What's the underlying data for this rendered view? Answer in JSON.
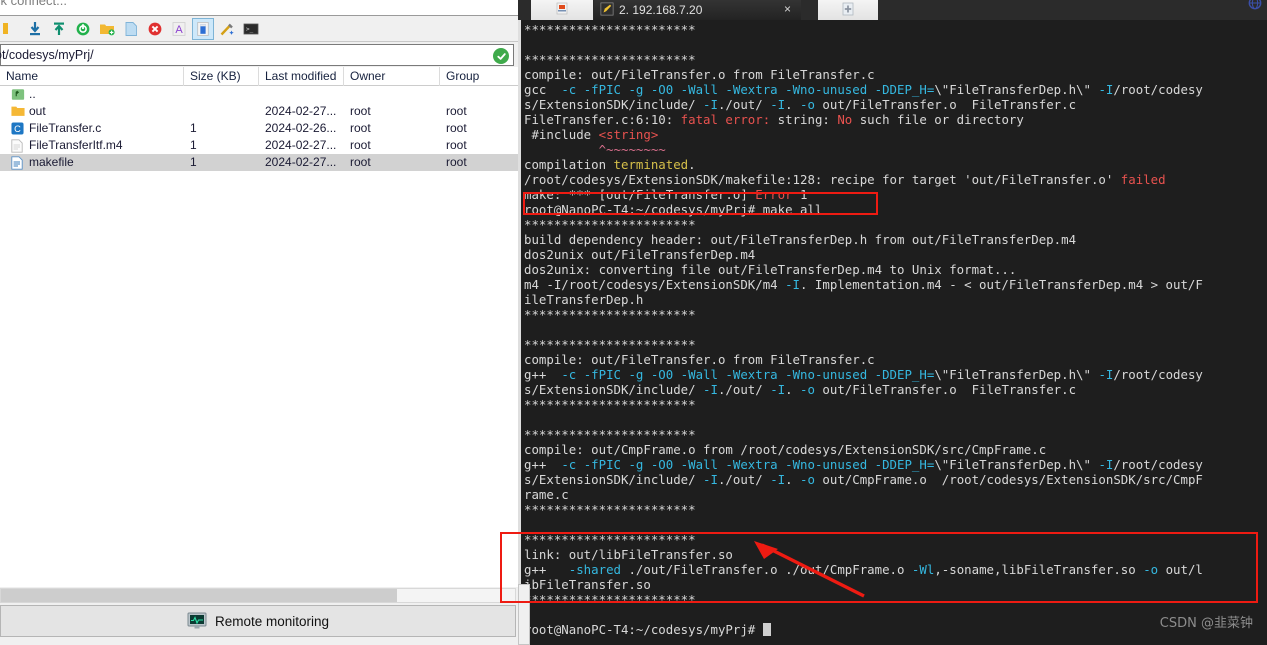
{
  "window": {
    "quick_connect_text": "ck connect...",
    "corner_icon": "globe-icon"
  },
  "file_manager": {
    "toolbar_items": [
      {
        "name": "download-icon",
        "label": "Download"
      },
      {
        "name": "download-arrow-icon",
        "label": "Download selected"
      },
      {
        "name": "upload-arrow-icon",
        "label": "Upload"
      },
      {
        "name": "refresh-icon",
        "label": "Refresh"
      },
      {
        "name": "new-folder-icon",
        "label": "New folder"
      },
      {
        "name": "new-file-icon",
        "label": "New file"
      },
      {
        "name": "delete-icon",
        "label": "Delete"
      },
      {
        "name": "rename-icon",
        "label": "Rename"
      },
      {
        "name": "properties-icon",
        "label": "Properties"
      },
      {
        "name": "magic-wand-icon",
        "label": "Tools"
      },
      {
        "name": "terminal-icon",
        "label": "Open terminal"
      }
    ],
    "address": {
      "path": "ot/codesys/myPrj/",
      "check_icon": "check-circle-icon"
    },
    "columns": [
      "Name",
      "Size (KB)",
      "Last modified",
      "Owner",
      "Group"
    ],
    "rows": [
      {
        "icon": "parent-folder-icon",
        "name": "..",
        "size": "",
        "modified": "",
        "owner": "",
        "group": "",
        "selected": false
      },
      {
        "icon": "folder-icon",
        "name": "out",
        "size": "",
        "modified": "2024-02-27...",
        "owner": "root",
        "group": "root",
        "selected": false
      },
      {
        "icon": "c-file-icon",
        "name": "FileTransfer.c",
        "size": "1",
        "modified": "2024-02-26...",
        "owner": "root",
        "group": "root",
        "selected": false
      },
      {
        "icon": "text-file-icon",
        "name": "FileTransferItf.m4",
        "size": "1",
        "modified": "2024-02-27...",
        "owner": "root",
        "group": "root",
        "selected": false
      },
      {
        "icon": "doc-file-icon",
        "name": "makefile",
        "size": "1",
        "modified": "2024-02-27...",
        "owner": "root",
        "group": "root",
        "selected": true
      }
    ],
    "bottom_bar": {
      "icon": "monitor-icon",
      "label": "Remote monitoring"
    }
  },
  "terminal": {
    "tabs": [
      {
        "label": "",
        "icon": "session-icon",
        "active": false
      },
      {
        "label": "2. 192.168.7.20",
        "icon": "pencil-icon",
        "active": true,
        "close": "×"
      },
      {
        "label": "+",
        "icon": "new-tab-icon",
        "active": false
      }
    ],
    "prompt": "root@NanoPC-T4:~/codesys/myPrj#",
    "lines": [
      [
        {
          "t": "***********************",
          "c": "white"
        }
      ],
      [
        {
          "t": "",
          "c": "white"
        }
      ],
      [
        {
          "t": "***********************",
          "c": "white"
        }
      ],
      [
        {
          "t": "compile: out/FileTransfer.o from FileTransfer.c",
          "c": "white"
        }
      ],
      [
        {
          "t": "gcc  ",
          "c": "white"
        },
        {
          "t": "-c -fPIC -g -O0 -Wall -Wextra -Wno-unused -DDEP_H=",
          "c": "cyan"
        },
        {
          "t": "\\\"FileTransferDep.h\\\" ",
          "c": "white"
        },
        {
          "t": "-I",
          "c": "cyan"
        },
        {
          "t": "/root/codesy",
          "c": "white"
        }
      ],
      [
        {
          "t": "s/ExtensionSDK/include/ ",
          "c": "white"
        },
        {
          "t": "-I",
          "c": "cyan"
        },
        {
          "t": "./out/ ",
          "c": "white"
        },
        {
          "t": "-I",
          "c": "cyan"
        },
        {
          "t": ". ",
          "c": "white"
        },
        {
          "t": "-o",
          "c": "cyan"
        },
        {
          "t": " out/FileTransfer.o  FileTransfer.c",
          "c": "white"
        }
      ],
      [
        {
          "t": "FileTransfer.c:6:10: ",
          "c": "white"
        },
        {
          "t": "fatal error:",
          "c": "red"
        },
        {
          "t": " string: ",
          "c": "white"
        },
        {
          "t": "No",
          "c": "red"
        },
        {
          "t": " such file or directory",
          "c": "white"
        }
      ],
      [
        {
          "t": " #include ",
          "c": "white"
        },
        {
          "t": "<string>",
          "c": "red"
        }
      ],
      [
        {
          "t": "          ",
          "c": "white"
        },
        {
          "t": "^~~~~~~~~",
          "c": "pink"
        }
      ],
      [
        {
          "t": "compilation ",
          "c": "white"
        },
        {
          "t": "terminated",
          "c": "yellow"
        },
        {
          "t": ".",
          "c": "white"
        }
      ],
      [
        {
          "t": "/root/codesys/ExtensionSDK/makefile:128: recipe for target 'out/FileTransfer.o' ",
          "c": "white"
        },
        {
          "t": "failed",
          "c": "red"
        }
      ],
      [
        {
          "t": "make: *** [out/FileTransfer.o] ",
          "c": "white"
        },
        {
          "t": "Error",
          "c": "red"
        },
        {
          "t": " 1",
          "c": "white"
        }
      ],
      [
        {
          "t": "root@NanoPC-T4:~/codesys/myPrj# make all",
          "c": "white"
        }
      ],
      [
        {
          "t": "***********************",
          "c": "white"
        }
      ],
      [
        {
          "t": "build dependency header: out/FileTransferDep.h from out/FileTransferDep.m4",
          "c": "white"
        }
      ],
      [
        {
          "t": "dos2unix out/FileTransferDep.m4",
          "c": "white"
        }
      ],
      [
        {
          "t": "dos2unix: converting file out/FileTransferDep.m4 to Unix format...",
          "c": "white"
        }
      ],
      [
        {
          "t": "m4 -I/root/codesys/ExtensionSDK/m4 ",
          "c": "white"
        },
        {
          "t": "-I",
          "c": "cyan"
        },
        {
          "t": ". Implementation.m4 - < out/FileTransferDep.m4 > out/F",
          "c": "white"
        }
      ],
      [
        {
          "t": "ileTransferDep.h",
          "c": "white"
        }
      ],
      [
        {
          "t": "***********************",
          "c": "white"
        }
      ],
      [
        {
          "t": "",
          "c": "white"
        }
      ],
      [
        {
          "t": "***********************",
          "c": "white"
        }
      ],
      [
        {
          "t": "compile: out/FileTransfer.o from FileTransfer.c",
          "c": "white"
        }
      ],
      [
        {
          "t": "g++  ",
          "c": "white"
        },
        {
          "t": "-c -fPIC -g -O0 -Wall -Wextra -Wno-unused -DDEP_H=",
          "c": "cyan"
        },
        {
          "t": "\\\"FileTransferDep.h\\\" ",
          "c": "white"
        },
        {
          "t": "-I",
          "c": "cyan"
        },
        {
          "t": "/root/codesy",
          "c": "white"
        }
      ],
      [
        {
          "t": "s/ExtensionSDK/include/ ",
          "c": "white"
        },
        {
          "t": "-I",
          "c": "cyan"
        },
        {
          "t": "./out/ ",
          "c": "white"
        },
        {
          "t": "-I",
          "c": "cyan"
        },
        {
          "t": ". ",
          "c": "white"
        },
        {
          "t": "-o",
          "c": "cyan"
        },
        {
          "t": " out/FileTransfer.o  FileTransfer.c",
          "c": "white"
        }
      ],
      [
        {
          "t": "***********************",
          "c": "white"
        }
      ],
      [
        {
          "t": "",
          "c": "white"
        }
      ],
      [
        {
          "t": "***********************",
          "c": "white"
        }
      ],
      [
        {
          "t": "compile: out/CmpFrame.o from /root/codesys/ExtensionSDK/src/CmpFrame.c",
          "c": "white"
        }
      ],
      [
        {
          "t": "g++  ",
          "c": "white"
        },
        {
          "t": "-c -fPIC -g -O0 -Wall -Wextra -Wno-unused -DDEP_H=",
          "c": "cyan"
        },
        {
          "t": "\\\"FileTransferDep.h\\\" ",
          "c": "white"
        },
        {
          "t": "-I",
          "c": "cyan"
        },
        {
          "t": "/root/codesy",
          "c": "white"
        }
      ],
      [
        {
          "t": "s/ExtensionSDK/include/ ",
          "c": "white"
        },
        {
          "t": "-I",
          "c": "cyan"
        },
        {
          "t": "./out/ ",
          "c": "white"
        },
        {
          "t": "-I",
          "c": "cyan"
        },
        {
          "t": ". ",
          "c": "white"
        },
        {
          "t": "-o",
          "c": "cyan"
        },
        {
          "t": " out/CmpFrame.o  /root/codesys/ExtensionSDK/src/CmpF",
          "c": "white"
        }
      ],
      [
        {
          "t": "rame.c",
          "c": "white"
        }
      ],
      [
        {
          "t": "***********************",
          "c": "white"
        }
      ],
      [
        {
          "t": "",
          "c": "white"
        }
      ],
      [
        {
          "t": "***********************",
          "c": "white"
        }
      ],
      [
        {
          "t": "link: out/libFileTransfer.so",
          "c": "white"
        }
      ],
      [
        {
          "t": "g++   ",
          "c": "white"
        },
        {
          "t": "-shared",
          "c": "cyan"
        },
        {
          "t": " ./out/FileTransfer.o ./out/CmpFrame.o ",
          "c": "white"
        },
        {
          "t": "-Wl",
          "c": "cyan"
        },
        {
          "t": ",-soname,libFileTransfer.so ",
          "c": "white"
        },
        {
          "t": "-o",
          "c": "cyan"
        },
        {
          "t": " out/l",
          "c": "white"
        }
      ],
      [
        {
          "t": "ibFileTransfer.so",
          "c": "white"
        }
      ],
      [
        {
          "t": "***********************",
          "c": "white"
        }
      ],
      [
        {
          "t": "",
          "c": "white"
        }
      ],
      [
        {
          "t": "root@NanoPC-T4:~/codesys/myPrj# ",
          "c": "white",
          "cursor": true
        }
      ]
    ]
  },
  "annotations": {
    "box_1_label": "highlight-make-all-command",
    "box_2_label": "highlight-link-output",
    "arrow_label": "pointer-to-link-target",
    "accent_color": "#ee1b12"
  },
  "watermark": "CSDN @韭菜钟"
}
